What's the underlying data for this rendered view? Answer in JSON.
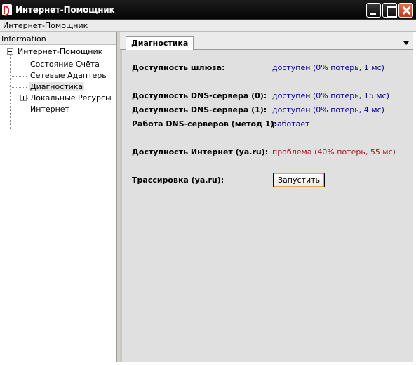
{
  "window": {
    "title": "Интернет-Помощник"
  },
  "menubar": {
    "item": "Интернет-Помощник"
  },
  "left_pane": {
    "header": "Information",
    "tree": {
      "root": "Интернет-Помощник",
      "items": [
        "Состояние Счёта",
        "Сетевые Адаптеры",
        "Диагностика",
        "Локальные Ресурсы",
        "Интернет"
      ],
      "selected": "Диагностика"
    }
  },
  "right_pane": {
    "tab": "Диагностика",
    "rows": [
      {
        "label": "Доступность шлюза:",
        "value": "доступен (0% потерь, 1 мс)",
        "status": "ok"
      },
      {
        "label": "Доступность DNS-сервера (0):",
        "value": "доступен (0% потерь, 15 мс)",
        "status": "ok"
      },
      {
        "label": "Доступность DNS-сервера (1):",
        "value": "доступен (0% потерь, 4 мс)",
        "status": "ok"
      },
      {
        "label": "Работа DNS-серверов (метод 1):",
        "value": "работает",
        "status": "ok"
      },
      {
        "label": "Доступность Интернет (ya.ru):",
        "value": "проблема (40% потерь, 55 мс)",
        "status": "problem"
      }
    ],
    "trace": {
      "label": "Трассировка (ya.ru):",
      "button": "Запустить"
    }
  },
  "colors": {
    "ok_text": "#000099",
    "problem_text": "#a02020",
    "title_bar": "#0a0a0a",
    "close_button": "#d44a25"
  }
}
